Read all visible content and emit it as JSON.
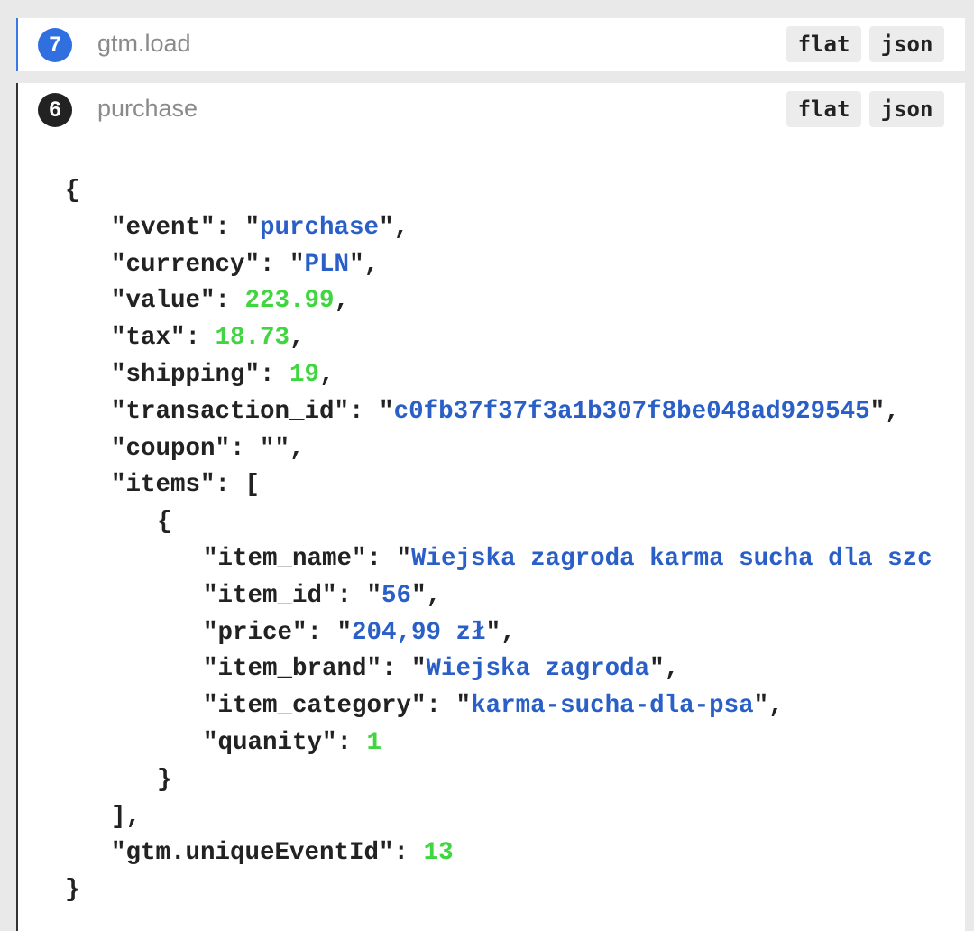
{
  "events": [
    {
      "number": "7",
      "name": "gtm.load",
      "flat_label": "flat",
      "json_label": "json",
      "badge_color": "#2f6fe0"
    },
    {
      "number": "6",
      "name": "purchase",
      "flat_label": "flat",
      "json_label": "json",
      "badge_color": "#222222"
    }
  ],
  "json_lines": [
    {
      "indent": 0,
      "tokens": [
        [
          "p",
          "{"
        ]
      ]
    },
    {
      "indent": 1,
      "tokens": [
        [
          "p",
          "\"event\": \""
        ],
        [
          "s",
          "purchase"
        ],
        [
          "p",
          "\","
        ]
      ]
    },
    {
      "indent": 1,
      "tokens": [
        [
          "p",
          "\"currency\": \""
        ],
        [
          "s",
          "PLN"
        ],
        [
          "p",
          "\","
        ]
      ]
    },
    {
      "indent": 1,
      "tokens": [
        [
          "p",
          "\"value\": "
        ],
        [
          "n",
          "223.99"
        ],
        [
          "p",
          ","
        ]
      ]
    },
    {
      "indent": 1,
      "tokens": [
        [
          "p",
          "\"tax\": "
        ],
        [
          "n",
          "18.73"
        ],
        [
          "p",
          ","
        ]
      ]
    },
    {
      "indent": 1,
      "tokens": [
        [
          "p",
          "\"shipping\": "
        ],
        [
          "n",
          "19"
        ],
        [
          "p",
          ","
        ]
      ]
    },
    {
      "indent": 1,
      "tokens": [
        [
          "p",
          "\"transaction_id\": \""
        ],
        [
          "s",
          "c0fb37f37f3a1b307f8be048ad929545"
        ],
        [
          "p",
          "\","
        ]
      ]
    },
    {
      "indent": 1,
      "tokens": [
        [
          "p",
          "\"coupon\": \"\","
        ]
      ]
    },
    {
      "indent": 1,
      "tokens": [
        [
          "p",
          "\"items\": ["
        ]
      ]
    },
    {
      "indent": 2,
      "tokens": [
        [
          "p",
          "{"
        ]
      ]
    },
    {
      "indent": 3,
      "tokens": [
        [
          "p",
          "\"item_name\": \""
        ],
        [
          "s",
          "Wiejska zagroda karma sucha dla szc"
        ]
      ]
    },
    {
      "indent": 3,
      "tokens": [
        [
          "p",
          "\"item_id\": \""
        ],
        [
          "s",
          "56"
        ],
        [
          "p",
          "\","
        ]
      ]
    },
    {
      "indent": 3,
      "tokens": [
        [
          "p",
          "\"price\": \""
        ],
        [
          "s",
          "204,99 zł"
        ],
        [
          "p",
          "\","
        ]
      ]
    },
    {
      "indent": 3,
      "tokens": [
        [
          "p",
          "\"item_brand\": \""
        ],
        [
          "s",
          "Wiejska zagroda"
        ],
        [
          "p",
          "\","
        ]
      ]
    },
    {
      "indent": 3,
      "tokens": [
        [
          "p",
          "\"item_category\": \""
        ],
        [
          "s",
          "karma-sucha-dla-psa"
        ],
        [
          "p",
          "\","
        ]
      ]
    },
    {
      "indent": 3,
      "tokens": [
        [
          "p",
          "\"quanity\": "
        ],
        [
          "n",
          "1"
        ]
      ]
    },
    {
      "indent": 2,
      "tokens": [
        [
          "p",
          "}"
        ]
      ]
    },
    {
      "indent": 1,
      "tokens": [
        [
          "p",
          "],"
        ]
      ]
    },
    {
      "indent": 1,
      "tokens": [
        [
          "p",
          "\"gtm.uniqueEventId\": "
        ],
        [
          "n",
          "13"
        ]
      ]
    },
    {
      "indent": 0,
      "tokens": [
        [
          "p",
          "}"
        ]
      ]
    }
  ]
}
